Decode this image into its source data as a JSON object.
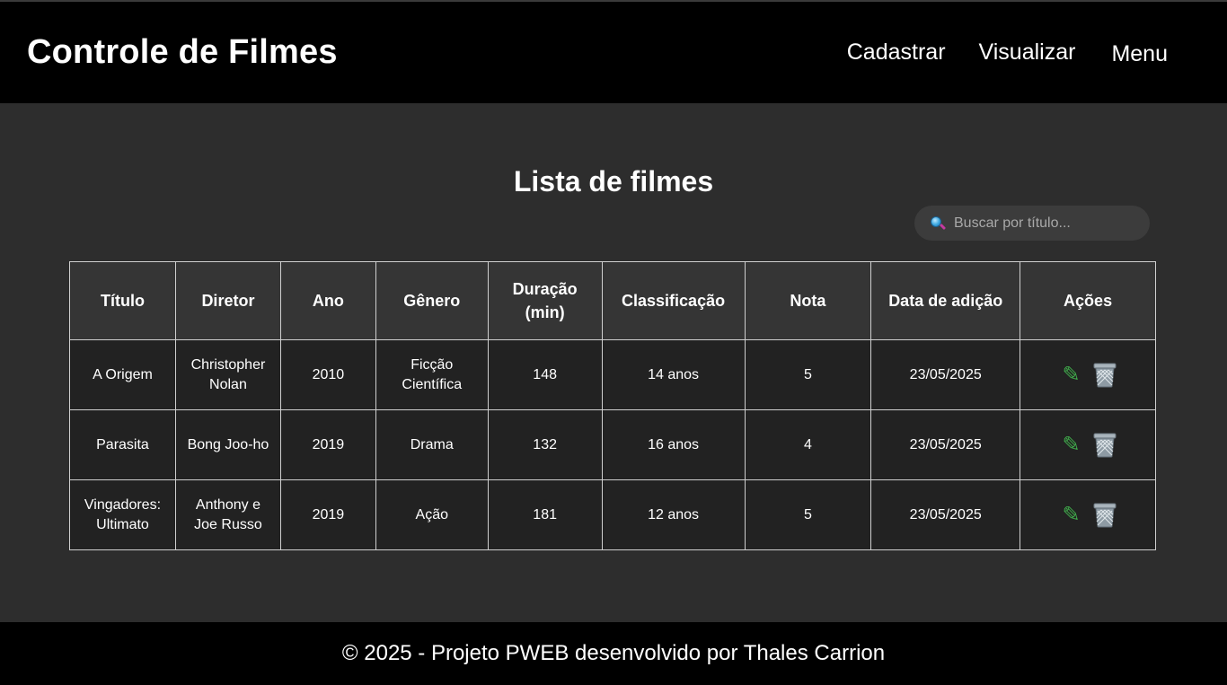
{
  "header": {
    "title": "Controle de Filmes",
    "nav": {
      "cadastrar": "Cadastrar",
      "visualizar": "Visualizar",
      "menu": "Menu"
    }
  },
  "main": {
    "title": "Lista de filmes",
    "search": {
      "placeholder": "Buscar por título...",
      "value": "",
      "icon": "magnifier-icon"
    },
    "table": {
      "headers": {
        "titulo": "Título",
        "diretor": "Diretor",
        "ano": "Ano",
        "genero": "Gênero",
        "duracao": "Duração (min)",
        "classificacao": "Classificação",
        "nota": "Nota",
        "data": "Data de adição",
        "acoes": "Ações"
      },
      "rows": [
        {
          "titulo": "A Origem",
          "diretor": "Christopher Nolan",
          "ano": "2010",
          "genero": "Ficção Científica",
          "duracao": "148",
          "classificacao": "14 anos",
          "nota": "5",
          "data": "23/05/2025"
        },
        {
          "titulo": "Parasita",
          "diretor": "Bong Joo-ho",
          "ano": "2019",
          "genero": "Drama",
          "duracao": "132",
          "classificacao": "16 anos",
          "nota": "4",
          "data": "23/05/2025"
        },
        {
          "titulo": "Vingadores: Ultimato",
          "diretor": "Anthony e Joe Russo",
          "ano": "2019",
          "genero": "Ação",
          "duracao": "181",
          "classificacao": "12 anos",
          "nota": "5",
          "data": "23/05/2025"
        }
      ],
      "actions": {
        "edit_icon": "pencil-icon",
        "delete_icon": "wastebasket-icon",
        "edit_color": "#3fa84a"
      }
    }
  },
  "footer": {
    "text": "© 2025 - Projeto PWEB desenvolvido por Thales Carrion"
  },
  "colors": {
    "header_bg": "#000000",
    "page_bg": "#2d2d2d",
    "table_header_bg": "#353535",
    "table_cell_bg": "#222222",
    "border": "#cfcfcf"
  }
}
